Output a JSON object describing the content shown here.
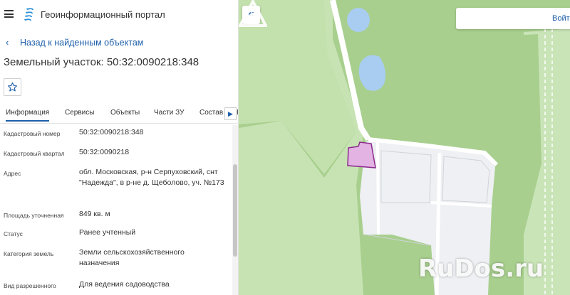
{
  "header": {
    "app_title": "Геоинформационный портал",
    "menu_icon": "hamburger-menu-icon",
    "logo_icon": "portal-logo-icon"
  },
  "navigation": {
    "back_label": "Назад к найденным объектам"
  },
  "object": {
    "title": "Земельный участок: 50:32:0090218:348",
    "favorite_icon": "star-icon"
  },
  "tabs": [
    {
      "label": "Информация",
      "active": true
    },
    {
      "label": "Сервисы",
      "active": false
    },
    {
      "label": "Объекты",
      "active": false
    },
    {
      "label": "Части ЗУ",
      "active": false
    },
    {
      "label": "Состав",
      "active": false
    }
  ],
  "tab_overflow": {
    "arrow": "▶",
    "cut_text": "I"
  },
  "attributes": [
    {
      "label": "Кадастровый номер",
      "value": "50:32:0090218:348"
    },
    {
      "label": "Кадастровый квартал",
      "value": "50:32:0090218"
    },
    {
      "label": "Адрес",
      "value": "обл. Московская, р-н Серпуховский, снт \"Надежда\", в р-не д. Щеболово, уч. №173"
    },
    {
      "label": "Площадь уточненная",
      "value": "849 кв. м"
    },
    {
      "label": "Статус",
      "value": "Ранее учтенный"
    },
    {
      "label": "Категория земель",
      "value": "Земли сельскохозяйственного назначения"
    },
    {
      "label": "Вид разрешенного",
      "value": "Для ведения садоводства"
    }
  ],
  "map": {
    "collapse_label": "«",
    "login_label": "Войт",
    "watermark": "RuDos.ru",
    "colors": {
      "forest": "#a8cf8e",
      "meadow": "#c7e3b3",
      "built_area": "#eef0f3",
      "water": "#a9cdf1",
      "road": "#ffffff",
      "parcel_fill": "#e2b3e3",
      "parcel_stroke": "#8a2a8c",
      "accent": "#1d5ea9"
    }
  }
}
